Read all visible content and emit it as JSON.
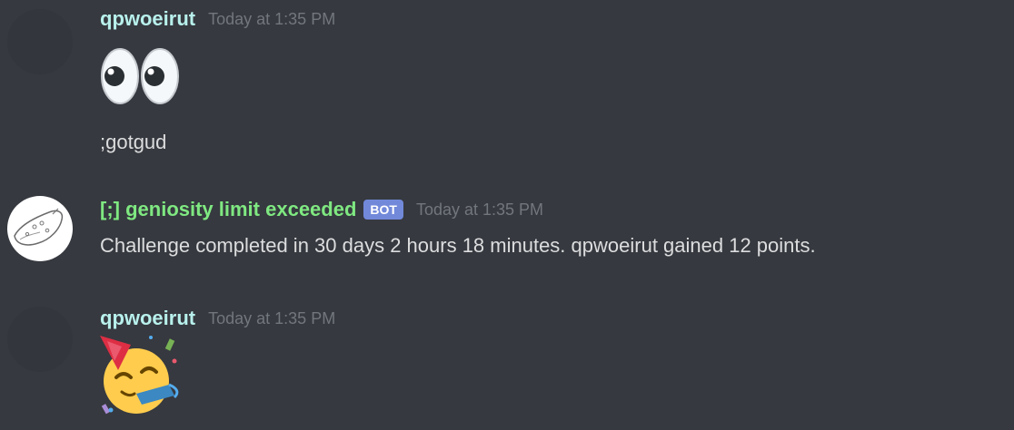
{
  "messages": [
    {
      "author": "qpwoeirut",
      "author_color": "#b8f0ec",
      "timestamp": "Today at 1:35 PM",
      "emoji": "eyes-emoji",
      "text": ";gotgud"
    },
    {
      "author": "[;] geniosity limit exceeded",
      "author_color": "#7fe881",
      "bot_tag": "BOT",
      "timestamp": "Today at 1:35 PM",
      "text": "Challenge completed in 30 days 2 hours 18 minutes. qpwoeirut gained 12 points."
    },
    {
      "author": "qpwoeirut",
      "author_color": "#b8f0ec",
      "timestamp": "Today at 1:35 PM",
      "emoji": "partying-face-emoji"
    }
  ]
}
